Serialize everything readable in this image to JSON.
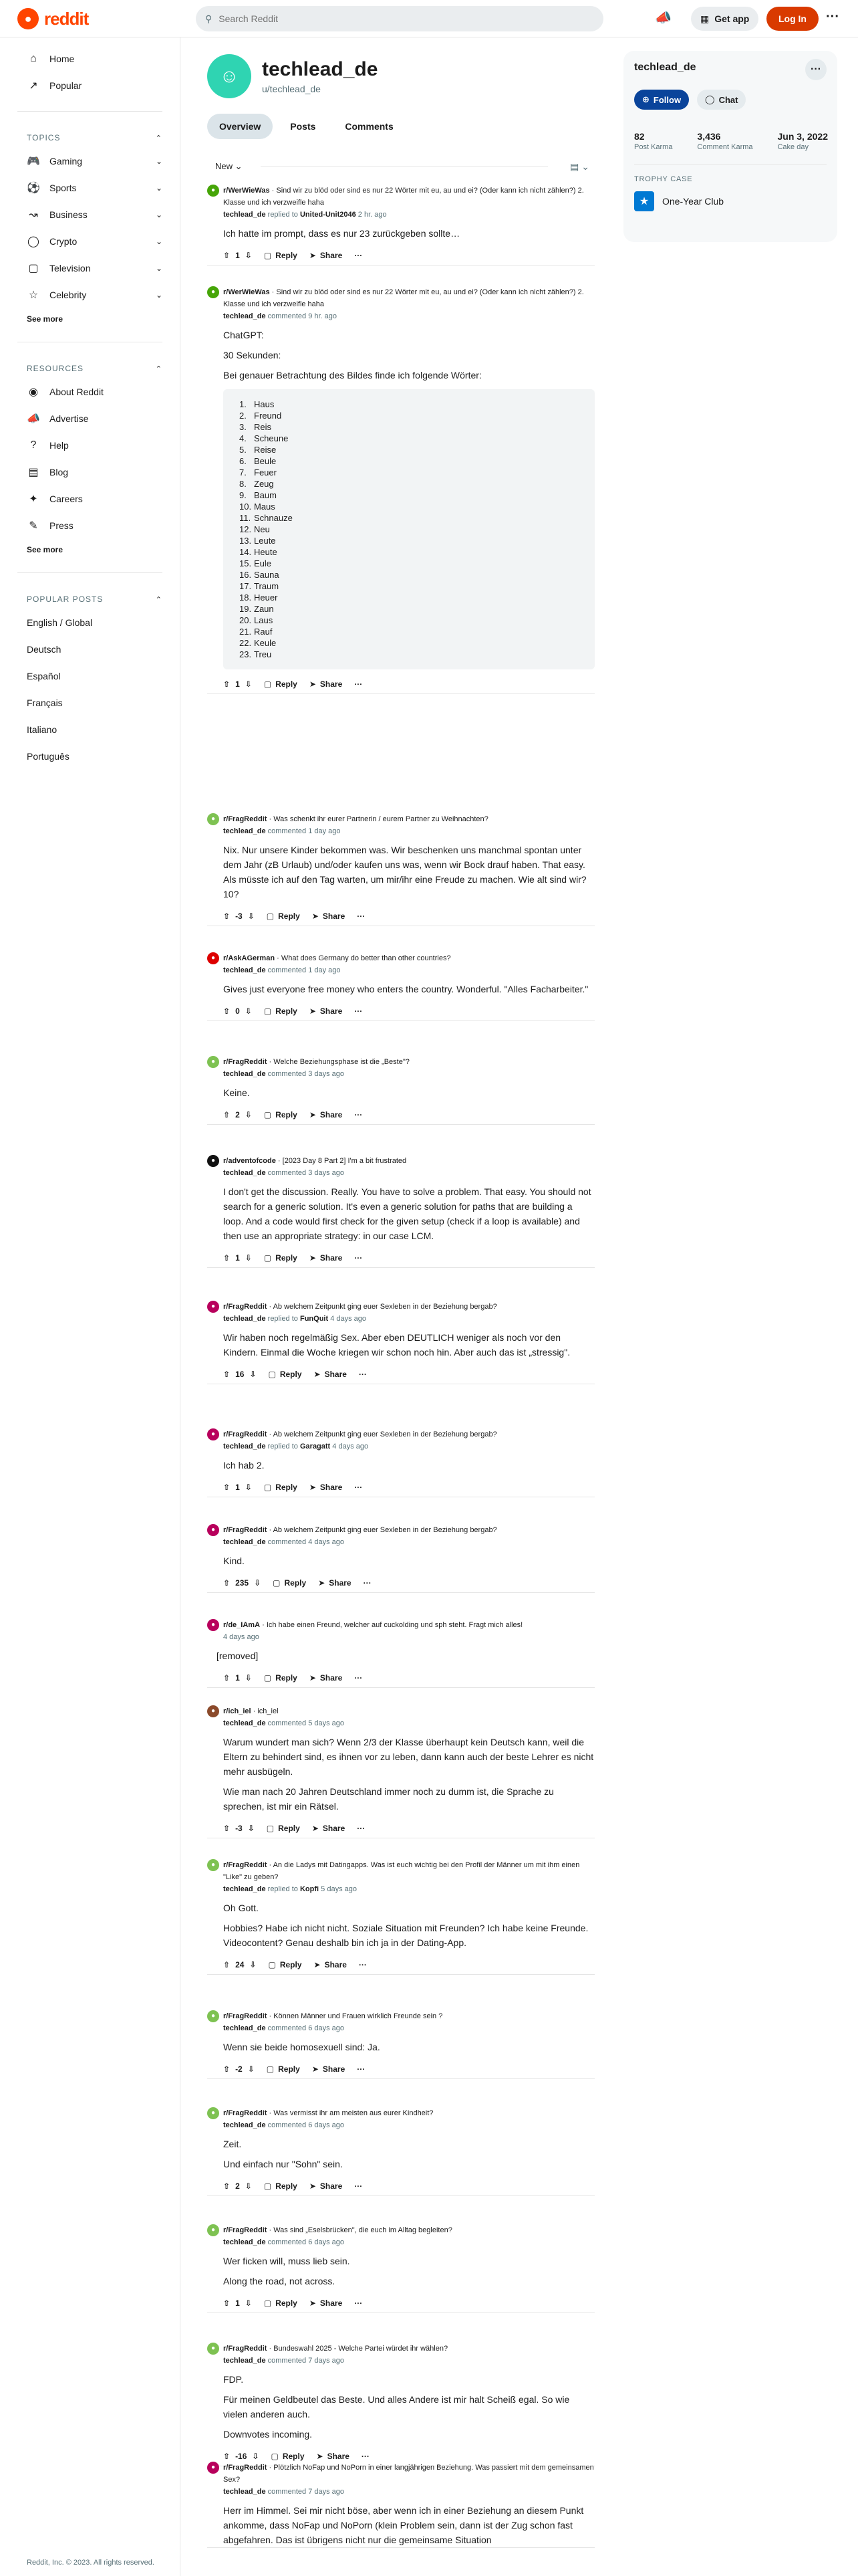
{
  "header": {
    "logo_text": "reddit",
    "search_placeholder": "Search Reddit",
    "get_app": "Get app",
    "login": "Log In"
  },
  "sidebar": {
    "nav": [
      "Home",
      "Popular"
    ],
    "topics_label": "TOPICS",
    "topics": [
      "Gaming",
      "Sports",
      "Business",
      "Crypto",
      "Television",
      "Celebrity"
    ],
    "see_more": "See more",
    "resources_label": "RESOURCES",
    "resources": [
      "About Reddit",
      "Advertise",
      "Help",
      "Blog",
      "Careers",
      "Press"
    ],
    "popular_label": "POPULAR POSTS",
    "popular": [
      "English / Global",
      "Deutsch",
      "Español",
      "Français",
      "Italiano",
      "Português"
    ],
    "copyright": "Reddit, Inc. © 2023. All rights reserved."
  },
  "profile": {
    "name": "techlead_de",
    "username": "u/techlead_de",
    "tabs": [
      "Overview",
      "Posts",
      "Comments"
    ],
    "sort": "New"
  },
  "right": {
    "name": "techlead_de",
    "follow": "Follow",
    "chat": "Chat",
    "stats": [
      {
        "value": "82",
        "label": "Post Karma"
      },
      {
        "value": "3,436",
        "label": "Comment Karma"
      },
      {
        "value": "Jun 3, 2022",
        "label": "Cake day"
      }
    ],
    "trophy_head": "TROPHY CASE",
    "trophy": "One-Year Club"
  },
  "labels": {
    "reply": "Reply",
    "share": "Share",
    "more": "···"
  },
  "comments": [
    {
      "sub": "r/WerWieWas",
      "title": "Sind wir zu blöd oder sind es nur 22 Wörter mit eu, au und ei? (Oder kann ich nicht zählen?) 2. Klasse und ich verzweifle haha",
      "author": "techlead_de",
      "verb": "replied to",
      "target": "United-Unit2046",
      "time": "2 hr. ago",
      "paras": [
        "Ich hatte im prompt, dass es nur 23 zurückgeben sollte…"
      ],
      "score": "1",
      "color": "#46a508"
    },
    {
      "sub": "r/WerWieWas",
      "title": "Sind wir zu blöd oder sind es nur 22 Wörter mit eu, au und ei? (Oder kann ich nicht zählen?) 2. Klasse und ich verzweifle haha",
      "author": "techlead_de",
      "verb": "commented",
      "target": "",
      "time": "9 hr. ago",
      "paras": [
        "ChatGPT:",
        "30 Sekunden:",
        "Bei genauer Betrachtung des Bildes finde ich folgende Wörter:"
      ],
      "list": [
        "Haus",
        "Freund",
        "Reis",
        "Scheune",
        "Reise",
        "Beule",
        "Feuer",
        "Zeug",
        "Baum",
        "Maus",
        "Schnauze",
        "Neu",
        "Leute",
        "Heute",
        "Eule",
        "Sauna",
        "Traum",
        "Heuer",
        "Zaun",
        "Laus",
        "Rauf",
        "Keule",
        "Treu"
      ],
      "score": "1",
      "color": "#46a508"
    },
    {
      "sub": "r/FragReddit",
      "title": "Was schenkt ihr eurer Partnerin / eurem Partner zu Weihnachten?",
      "author": "techlead_de",
      "verb": "commented",
      "target": "",
      "time": "1 day ago",
      "paras": [
        "Nix. Nur unsere Kinder bekommen was. Wir beschenken uns manchmal spontan unter dem Jahr (zB Urlaub) und/oder kaufen uns was, wenn wir Bock drauf haben. That easy. Als müsste ich auf den Tag warten, um mir/ihr eine Freude zu machen. Wie alt sind wir? 10?"
      ],
      "score": "-3",
      "color": "#7ec252"
    },
    {
      "sub": "r/AskAGerman",
      "title": "What does Germany do better than other countries?",
      "author": "techlead_de",
      "verb": "commented",
      "target": "",
      "time": "1 day ago",
      "paras": [
        "Gives just everyone free money who enters the country. Wonderful. \"Alles Facharbeiter.\""
      ],
      "score": "0",
      "color": "#dd0000"
    },
    {
      "sub": "r/FragReddit",
      "title": "Welche Beziehungsphase ist die „Beste\"?",
      "author": "techlead_de",
      "verb": "commented",
      "target": "",
      "time": "3 days ago",
      "paras": [
        "Keine."
      ],
      "score": "2",
      "color": "#7ec252"
    },
    {
      "sub": "r/adventofcode",
      "title": "[2023 Day 8 Part 2] I'm a bit frustrated",
      "author": "techlead_de",
      "verb": "commented",
      "target": "",
      "time": "3 days ago",
      "paras": [
        "I don't get the discussion. Really. You have to solve a problem. That easy. You should not search for a generic solution. It's even a generic solution for paths that are building a loop. And a code would first check for the given setup (check if a loop is available) and then use an appropriate strategy: in our case LCM."
      ],
      "score": "1",
      "color": "#111111"
    },
    {
      "sub": "r/FragReddit",
      "title": "Ab welchem Zeitpunkt ging euer Sexleben in der Beziehung bergab?",
      "author": "techlead_de",
      "verb": "replied to",
      "target": "FunQuit",
      "time": "4 days ago",
      "paras": [
        "Wir haben noch regelmäßig Sex. Aber eben DEUTLICH weniger als noch vor den Kindern. Einmal die Woche kriegen wir schon noch hin. Aber auch das ist „stressig\"."
      ],
      "score": "16",
      "color": "#b8005c"
    },
    {
      "sub": "r/FragReddit",
      "title": "Ab welchem Zeitpunkt ging euer Sexleben in der Beziehung bergab?",
      "author": "techlead_de",
      "verb": "replied to",
      "target": "Garagatt",
      "time": "4 days ago",
      "paras": [
        "Ich hab 2."
      ],
      "score": "1",
      "color": "#b8005c"
    },
    {
      "sub": "r/FragReddit",
      "title": "Ab welchem Zeitpunkt ging euer Sexleben in der Beziehung bergab?",
      "author": "techlead_de",
      "verb": "commented",
      "target": "",
      "time": "4 days ago",
      "paras": [
        "Kind."
      ],
      "score": "235",
      "color": "#b8005c"
    },
    {
      "sub": "r/de_IAmA",
      "title": "Ich habe einen Freund, welcher auf cuckolding und sph steht. Fragt mich alles!",
      "author": "",
      "verb": "",
      "target": "",
      "time": "4 days ago",
      "removed": "[removed]",
      "paras": [],
      "score": "1",
      "color": "#b8005c"
    },
    {
      "sub": "r/ich_iel",
      "title": "ich_iel",
      "author": "techlead_de",
      "verb": "commented",
      "target": "",
      "time": "5 days ago",
      "paras": [
        "Warum wundert man sich? Wenn 2/3 der Klasse überhaupt kein Deutsch kann, weil die Eltern zu behindert sind, es ihnen vor zu leben, dann kann auch der beste Lehrer es nicht mehr ausbügeln.",
        "Wie man nach 20 Jahren Deutschland immer noch zu dumm ist, die Sprache zu sprechen, ist mir ein Rätsel."
      ],
      "score": "-3",
      "color": "#8b4a2b"
    },
    {
      "sub": "r/FragReddit",
      "title": "An die Ladys mit Datingapps. Was ist euch wichtig bei den Profil der Männer um mit ihm einen \"Like\" zu geben?",
      "author": "techlead_de",
      "verb": "replied to",
      "target": "Kopfi",
      "time": "5 days ago",
      "paras": [
        "Oh Gott.",
        "Hobbies? Habe ich nicht nicht. Soziale Situation mit Freunden? Ich habe keine Freunde. Videocontent? Genau deshalb bin ich ja in der Dating-App."
      ],
      "score": "24",
      "color": "#7ec252"
    },
    {
      "sub": "r/FragReddit",
      "title": "Können Männer und Frauen wirklich Freunde sein ?",
      "author": "techlead_de",
      "verb": "commented",
      "target": "",
      "time": "6 days ago",
      "paras": [
        "Wenn sie beide homosexuell sind: Ja."
      ],
      "score": "-2",
      "color": "#7ec252"
    },
    {
      "sub": "r/FragReddit",
      "title": "Was vermisst ihr am meisten aus eurer Kindheit?",
      "author": "techlead_de",
      "verb": "commented",
      "target": "",
      "time": "6 days ago",
      "paras": [
        "Zeit.",
        "Und einfach nur \"Sohn\" sein."
      ],
      "score": "2",
      "color": "#7ec252"
    },
    {
      "sub": "r/FragReddit",
      "title": "Was sind „Eselsbrücken\", die euch im Alltag begleiten?",
      "author": "techlead_de",
      "verb": "commented",
      "target": "",
      "time": "6 days ago",
      "paras": [
        "Wer ficken will, muss lieb sein.",
        "Along the road, not across."
      ],
      "score": "1",
      "color": "#7ec252"
    },
    {
      "sub": "r/FragReddit",
      "title": "Bundeswahl 2025 - Welche Partei würdet ihr wählen?",
      "author": "techlead_de",
      "verb": "commented",
      "target": "",
      "time": "7 days ago",
      "paras": [
        "FDP.",
        "Für meinen Geldbeutel das Beste. Und alles Andere ist mir halt Scheiß egal. So wie vielen anderen auch.",
        "Downvotes incoming."
      ],
      "score": "-16",
      "color": "#7ec252"
    },
    {
      "sub": "r/FragReddit",
      "title": "Plötzlich NoFap und NoPorn in einer langjährigen Beziehung. Was passiert mit dem gemeinsamen Sex?",
      "author": "techlead_de",
      "verb": "commented",
      "target": "",
      "time": "7 days ago",
      "paras": [
        "Herr im Himmel. Sei mir nicht böse, aber wenn ich in einer Beziehung an diesem Punkt ankomme, dass NoFap und NoPorn (klein Problem sein, dann ist der Zug schon fast abgefahren. Das ist übrigens nicht nur die gemeinsame Situation"
      ],
      "score": "",
      "color": "#b8005c"
    }
  ]
}
